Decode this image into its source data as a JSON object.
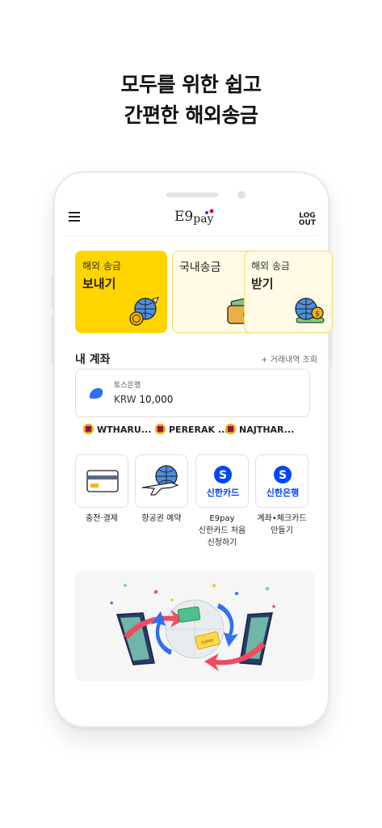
{
  "headline": {
    "line1_highlight": "모두를 위한",
    "line1_rest": " 쉽고",
    "line2": "간편한 해외송금"
  },
  "topbar": {
    "logo_main": "E9",
    "logo_sub": "pay",
    "logout_line1": "LOG",
    "logout_line2": "OUT"
  },
  "cards": [
    {
      "line1": "해외 송금",
      "line2": "보내기",
      "icon": "globe-plane-coin-icon"
    },
    {
      "line1": "국내송금",
      "line2": "",
      "icon": "wallet-icon"
    },
    {
      "line1": "해외 송금",
      "line2": "받기",
      "icon": "globe-coin-icon"
    }
  ],
  "account": {
    "title": "내 계좌",
    "link": "+ 거래내역 조회",
    "bank": "토스은행",
    "currency": "KRW",
    "amount": "10,000"
  },
  "recipients": [
    {
      "name": "WTHARU...",
      "flag": "sri-lanka-flag-icon"
    },
    {
      "name": "PERERAK ...",
      "flag": "sri-lanka-flag-icon"
    },
    {
      "name": "NAJTHAR...",
      "flag": "sri-lanka-flag-icon"
    }
  ],
  "services": [
    {
      "label_lines": [
        "충전·결제"
      ],
      "icon": "card-icon"
    },
    {
      "label_lines": [
        "항공권 예약"
      ],
      "icon": "airplane-icon"
    },
    {
      "label_lines": [
        "E9pay",
        "신한카드 처음",
        "신청하기"
      ],
      "icon_text": "신한카드",
      "icon": "shinhan-card-icon"
    },
    {
      "label_lines": [
        "계좌•체크카드",
        "만들기"
      ],
      "icon_text": "신한은행",
      "icon": "shinhan-bank-icon"
    }
  ],
  "banner": {
    "badge_text": "E9PAY"
  },
  "colors": {
    "accent": "#ffd400",
    "card_bg": "#fffbe6",
    "shinhan_blue": "#0046ff",
    "bank_blue": "#2d6ff5"
  }
}
